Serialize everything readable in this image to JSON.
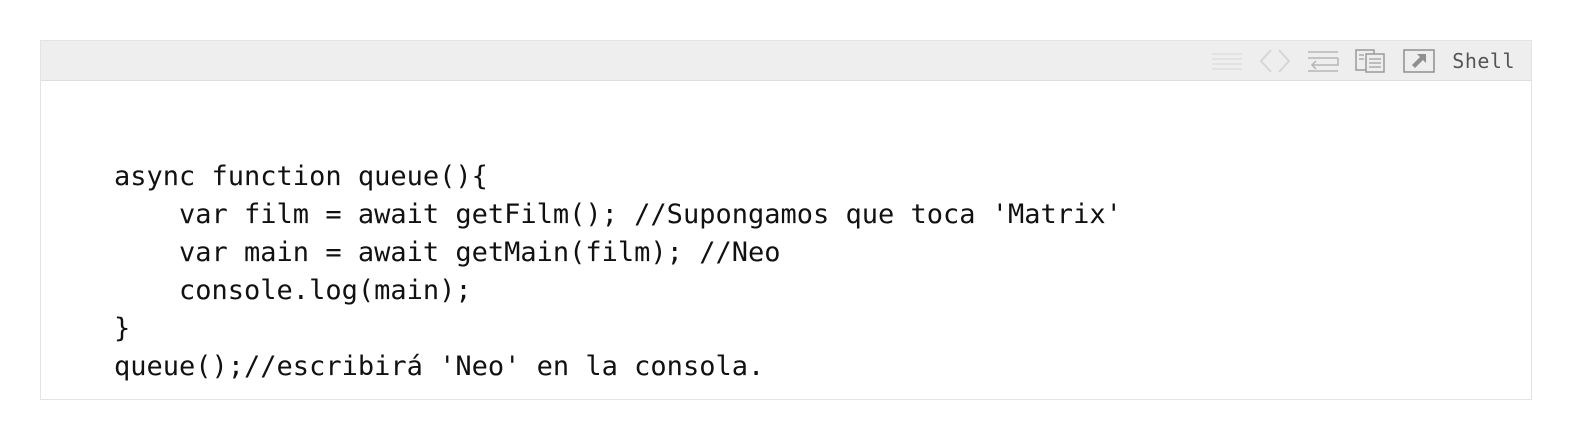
{
  "toolbar": {
    "language_label": "Shell",
    "icons": [
      "view-source-icon",
      "code-brackets-icon",
      "wrap-lines-icon",
      "copy-icon",
      "open-new-window-icon"
    ]
  },
  "code": {
    "lines": [
      "async function queue(){",
      "    var film = await getFilm(); //Supongamos que toca 'Matrix'",
      "    var main = await getMain(film); //Neo",
      "    console.log(main);",
      "}",
      "queue();//escribirá 'Neo' en la consola."
    ]
  },
  "colors": {
    "toolbar_bg": "#eeeeee",
    "icon": "#c8c8c8",
    "icon_active": "#9a9a9a",
    "code_text": "#111111"
  }
}
